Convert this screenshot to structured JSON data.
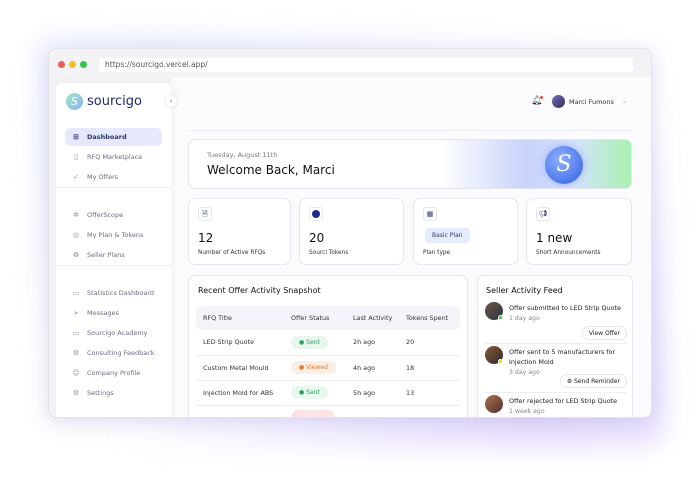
{
  "browser": {
    "url": "https://sourcigo.vercel.app/"
  },
  "sidebar": {
    "logo": "sourcigo",
    "groups": [
      [
        {
          "label": "Dashboard",
          "icon": "grid-icon",
          "active": true
        },
        {
          "label": "RFQ Marketplace",
          "icon": "book-icon"
        },
        {
          "label": "My Offers",
          "icon": "double-check-icon"
        }
      ],
      [
        {
          "label": "OfferScope",
          "icon": "aperture-icon"
        },
        {
          "label": "My Plan & Tokens",
          "icon": "coin-icon"
        },
        {
          "label": "Seller Plans",
          "icon": "plans-icon"
        }
      ],
      [
        {
          "label": "Statistics Dashboard",
          "icon": "chart-icon"
        },
        {
          "label": "Messages",
          "icon": "send-icon"
        },
        {
          "label": "Sourcigo Academy",
          "icon": "academy-icon"
        },
        {
          "label": "Consulting Feedback",
          "icon": "gear-icon"
        },
        {
          "label": "Company Profile",
          "icon": "user-icon"
        },
        {
          "label": "Settings",
          "icon": "settings-icon"
        }
      ]
    ]
  },
  "header": {
    "user_name": "Marci Fumons"
  },
  "welcome": {
    "date": "Tuesday, August 11th",
    "title": "Welcome Back, Marci"
  },
  "stats": [
    {
      "value": "12",
      "label": "Number of Active RFQs"
    },
    {
      "value": "20",
      "label": "Sourci Tokens"
    },
    {
      "badge": "Basic Plan",
      "label": "Plan type"
    },
    {
      "value": "1 new",
      "label": "Short Announcements"
    }
  ],
  "table": {
    "title": "Recent Offer Activity Snapshot",
    "headers": [
      "RFQ Title",
      "Offer Status",
      "Last Activity",
      "Tokens Spent"
    ],
    "rows": [
      {
        "title": "LED Strip Quote",
        "status": "Sent",
        "last": "2h ago",
        "tokens": "20"
      },
      {
        "title": "Custom Metal Mould",
        "status": "Viewed",
        "last": "4h ago",
        "tokens": "18"
      },
      {
        "title": "Injection Mold for ABS",
        "status": "Sent",
        "last": "5h ago",
        "tokens": "13"
      }
    ]
  },
  "feed": {
    "title": "Seller Activity Feed",
    "items": [
      {
        "text": "Offer submitted to LED Strip Quote",
        "time": "1 day ago",
        "button": "View Offer"
      },
      {
        "text": "Offer sent to 5 manufacturers for Injection Mold",
        "time": "3 day ago",
        "button": "Send Reminder"
      },
      {
        "text": "Offer rejected for LED Strip Quote",
        "time": "1 week ago"
      }
    ]
  },
  "colors": {
    "accent": "#2b3470",
    "sent_bg": "#e8f8ee",
    "sent_fg": "#2ea15a",
    "viewed_bg": "#fdeee3",
    "viewed_fg": "#e07a30"
  }
}
